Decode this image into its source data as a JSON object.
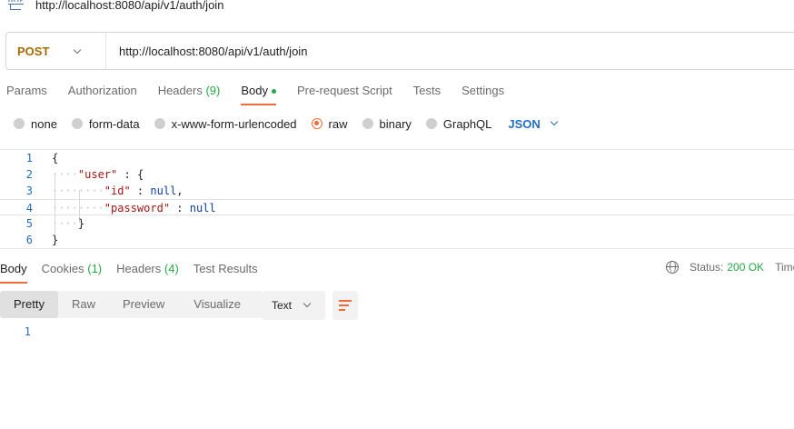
{
  "window": {
    "title": "http://localhost:8080/api/v1/auth/join",
    "icon": "http-icon"
  },
  "request": {
    "method": "POST",
    "url": "http://localhost:8080/api/v1/auth/join"
  },
  "request_tabs": {
    "params": "Params",
    "authorization": "Authorization",
    "headers": "Headers",
    "headers_count": "(9)",
    "body": "Body",
    "pre_request": "Pre-request Script",
    "tests": "Tests",
    "settings": "Settings",
    "active": "Body"
  },
  "body_options": {
    "none": "none",
    "form_data": "form-data",
    "urlencoded": "x-www-form-urlencoded",
    "raw": "raw",
    "binary": "binary",
    "graphql": "GraphQL",
    "selected": "raw",
    "format": "JSON"
  },
  "editor": {
    "line_numbers": [
      "1",
      "2",
      "3",
      "4",
      "5",
      "6"
    ],
    "lines": {
      "l1_brace": "{",
      "l2_key": "\"user\"",
      "l2_rest": " : {",
      "l3_key": "\"id\"",
      "l3_sep": " : ",
      "l3_val": "null",
      "l3_comma": ",",
      "l4_key": "\"password\"",
      "l4_sep": " : ",
      "l4_val": "null",
      "l5_brace": "}",
      "l6_brace": "}"
    }
  },
  "response_tabs": {
    "body": "Body",
    "cookies": "Cookies",
    "cookies_count": "(1)",
    "headers": "Headers",
    "headers_count": "(4)",
    "test_results": "Test Results",
    "active": "Body"
  },
  "response_status": {
    "label": "Status:",
    "value": "200 OK",
    "time_label": "Time"
  },
  "response_view": {
    "modes": [
      "Pretty",
      "Raw",
      "Preview",
      "Visualize"
    ],
    "active": "Pretty",
    "type": "Text",
    "line_numbers": [
      "1"
    ]
  },
  "colors": {
    "accent": "#f26b3a",
    "method": "#a56b00",
    "link_blue": "#1f6fc5",
    "success": "#28a745"
  }
}
